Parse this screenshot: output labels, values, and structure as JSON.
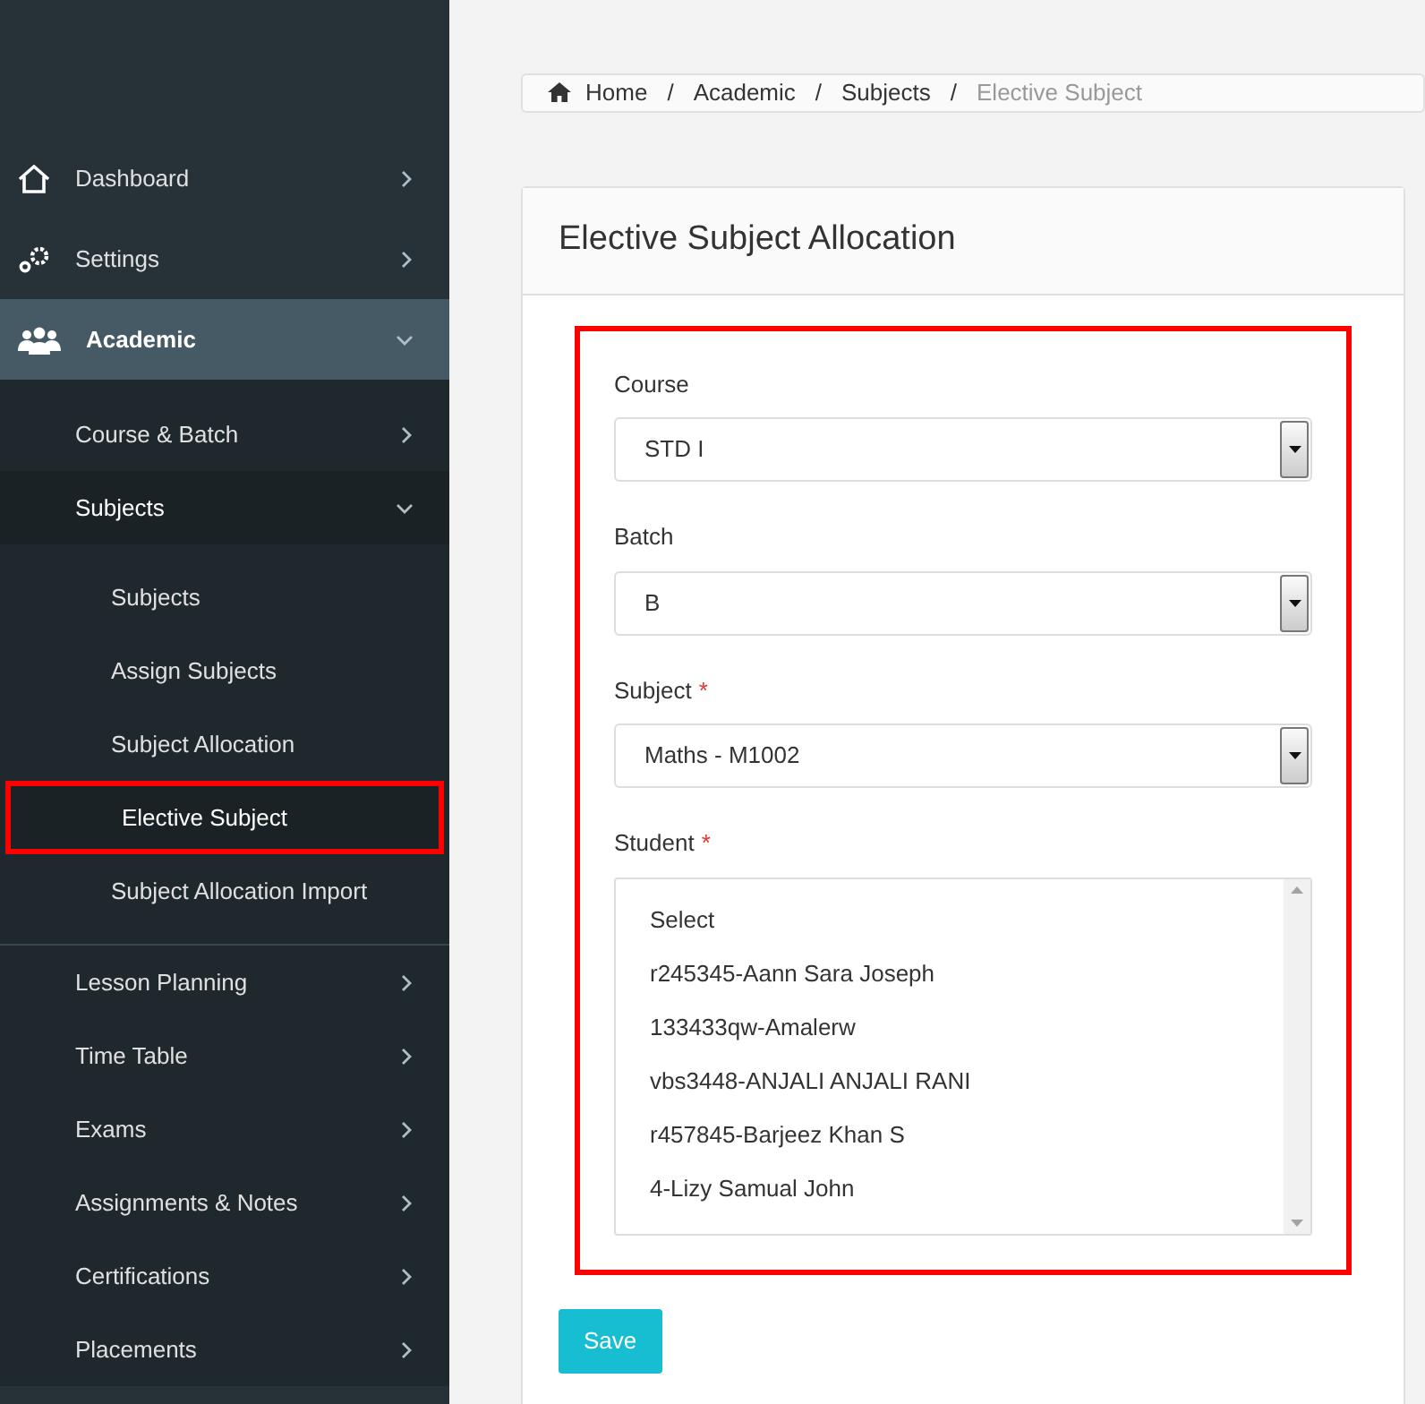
{
  "sidebar": {
    "items": [
      {
        "label": "Dashboard",
        "expanded": false,
        "selected": false
      },
      {
        "label": "Settings",
        "expanded": false,
        "selected": false
      },
      {
        "label": "Academic",
        "expanded": true,
        "selected": true,
        "children": [
          {
            "label": "Course & Batch",
            "expanded": false,
            "selected": false
          },
          {
            "label": "Subjects",
            "expanded": true,
            "selected": true,
            "children": [
              {
                "label": "Subjects",
                "selected": false,
                "highlighted": false
              },
              {
                "label": "Assign Subjects",
                "selected": false,
                "highlighted": false
              },
              {
                "label": "Subject Allocation",
                "selected": false,
                "highlighted": false
              },
              {
                "label": "Elective Subject",
                "selected": true,
                "highlighted": true
              },
              {
                "label": "Subject Allocation Import",
                "selected": false,
                "highlighted": false
              }
            ]
          },
          {
            "label": "Lesson Planning",
            "expanded": false,
            "selected": false
          },
          {
            "label": "Time Table",
            "expanded": false,
            "selected": false
          },
          {
            "label": "Exams",
            "expanded": false,
            "selected": false
          },
          {
            "label": "Assignments & Notes",
            "expanded": false,
            "selected": false
          },
          {
            "label": "Certifications",
            "expanded": false,
            "selected": false
          },
          {
            "label": "Placements",
            "expanded": false,
            "selected": false
          }
        ]
      }
    ]
  },
  "breadcrumb": {
    "separator": "/",
    "items": [
      "Home",
      "Academic",
      "Subjects",
      "Elective Subject"
    ]
  },
  "card": {
    "title": "Elective Subject Allocation",
    "highlighted": true,
    "fields": [
      {
        "kind": "select",
        "label": "Course",
        "value": "STD I"
      },
      {
        "kind": "select",
        "label": "Batch",
        "value": "B"
      },
      {
        "kind": "select",
        "label": "Subject",
        "required_mark": "*",
        "value": "Maths - M1002"
      },
      {
        "kind": "listbox",
        "label": "Student",
        "required_mark": "*",
        "options": [
          "Select",
          "r245345-Aann Sara Joseph",
          "133433qw-Amalerw",
          "vbs3448-ANJALI ANJALI RANI",
          "r457845-Barjeez Khan S",
          "4-Lizy Samual John"
        ]
      }
    ],
    "button": "Save"
  }
}
